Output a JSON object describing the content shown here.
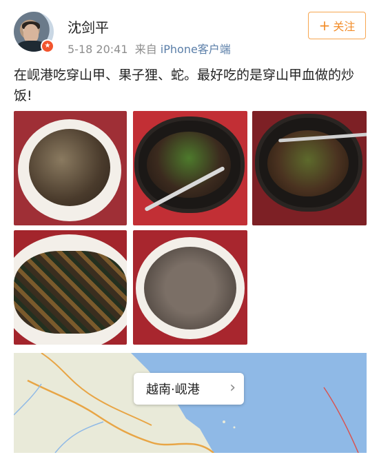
{
  "post": {
    "username": "沈剑平",
    "date": "5-18",
    "time": "20:41",
    "source_prefix": "来自",
    "source": "iPhone客户端",
    "follow_label": "关注",
    "follow_icon": "plus-icon",
    "badge_icon": "verified-badge-icon",
    "text": "在岘港吃穿山甲、果子狸、蛇。最好吃的是穿山甲血做的炒饭!"
  },
  "photos": [
    {
      "name": "dish-photo-1"
    },
    {
      "name": "dish-photo-2"
    },
    {
      "name": "dish-photo-3"
    },
    {
      "name": "dish-photo-4"
    },
    {
      "name": "dish-photo-5"
    }
  ],
  "location": {
    "label": "越南·岘港",
    "icon": "chevron-right-icon"
  },
  "colors": {
    "follow_accent": "#f28c28",
    "source_link": "#5a7ea8",
    "badge": "#f2542d",
    "sea": "#8fb9e6"
  }
}
